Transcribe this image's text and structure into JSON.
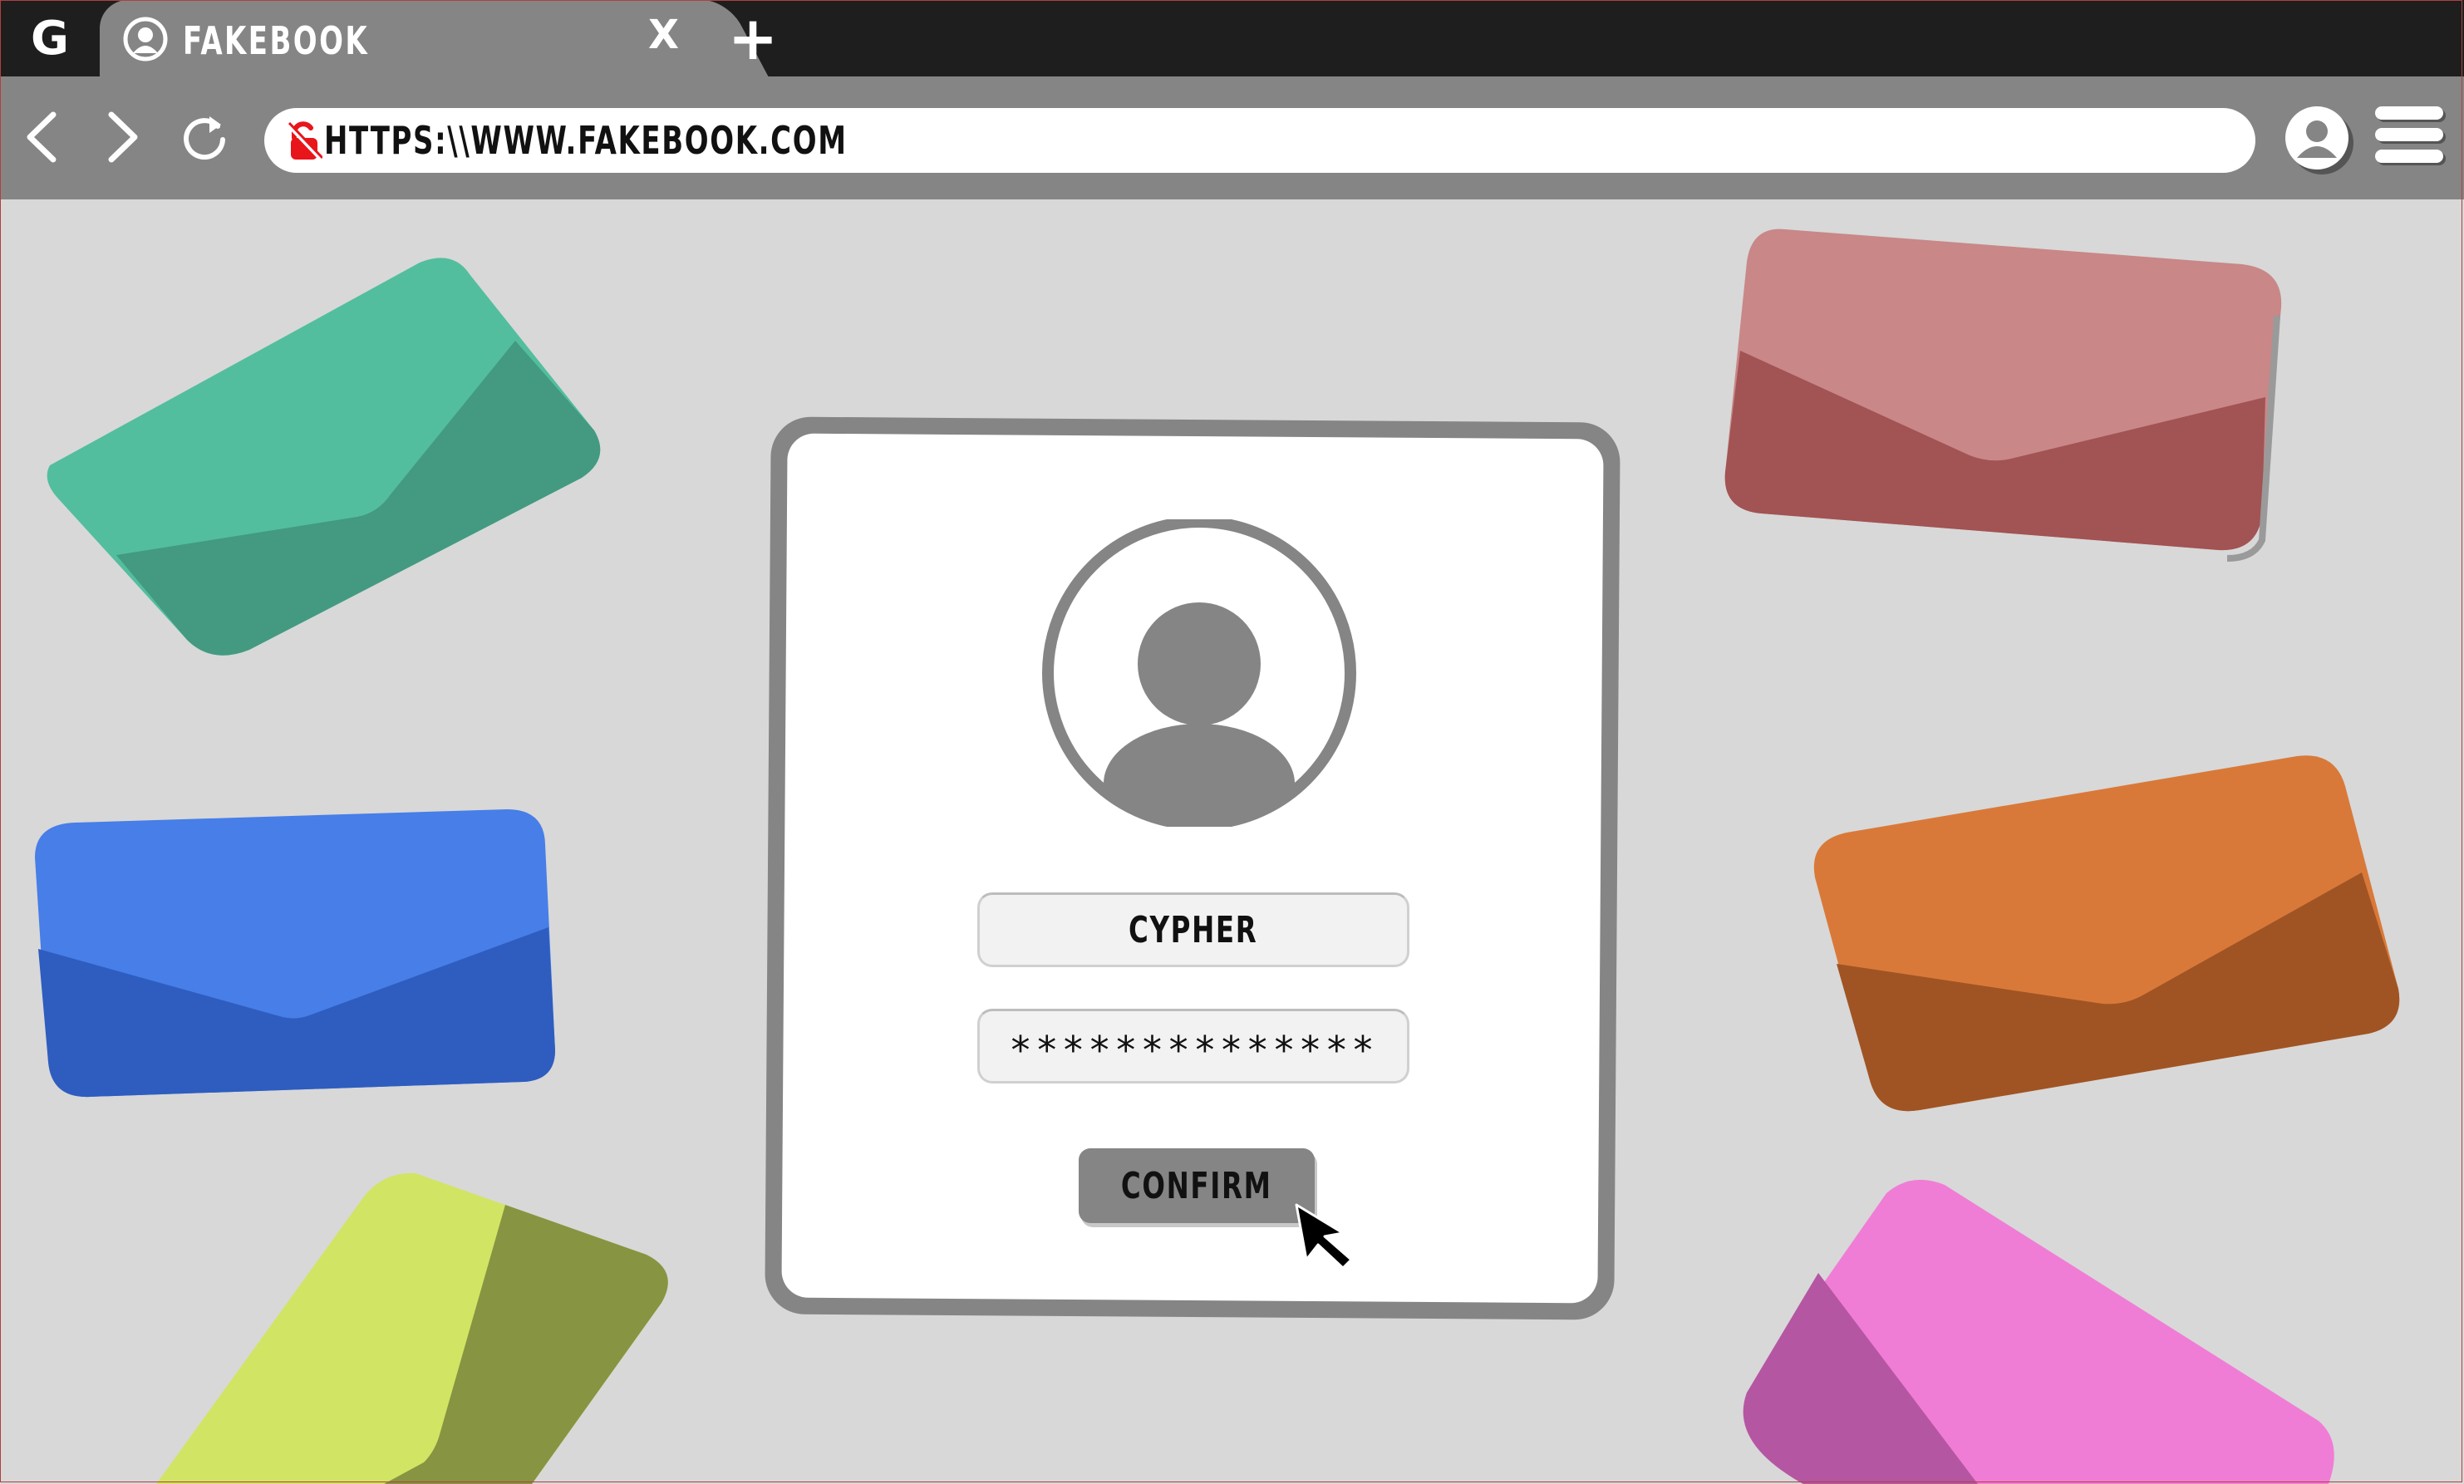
{
  "browser": {
    "tab": {
      "title": "FAKEBOOK",
      "close_label": "X",
      "icon": "user-circle-icon"
    },
    "logo_letter": "G",
    "new_tab_label": "+",
    "address_bar": {
      "url": "HTTPS:\\\\WWW.FAKEBOOK.COM",
      "lock_icon": "broken-lock-icon",
      "lock_color": "#e8151b"
    },
    "icons": {
      "back": "chevron-left-icon",
      "forward": "chevron-right-icon",
      "reload": "reload-icon",
      "profile": "profile-icon",
      "menu": "hamburger-menu-icon"
    }
  },
  "login": {
    "avatar_icon": "user-avatar-icon",
    "username_value": "CYPHER",
    "password_value": "**************",
    "confirm_label": "CONFIRM",
    "cursor_icon": "mouse-pointer-icon"
  },
  "decorations": {
    "envelope_colors": {
      "green": "#52be9e",
      "pink_red": "#c98788",
      "blue": "#477ee8",
      "orange": "#d97939",
      "yellow_green": "#d2e463",
      "magenta": "#f07dd5"
    }
  },
  "colors": {
    "background": "#d8d8d8",
    "chrome": "#858585",
    "tabbar": "#1e1e1e"
  }
}
